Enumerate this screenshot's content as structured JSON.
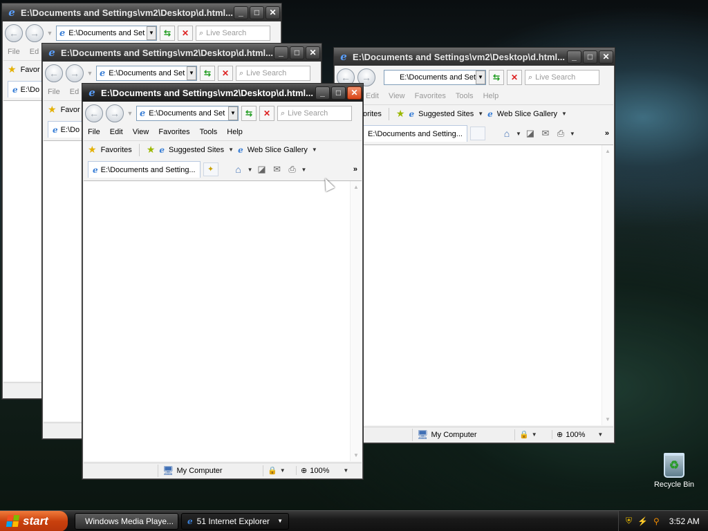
{
  "window": {
    "title": "E:\\Documents and Settings\\vm2\\Desktop\\d.html...",
    "address": "E:\\Documents and Set",
    "search_placeholder": "Live Search",
    "menu": [
      "File",
      "Edit",
      "View",
      "Favorites",
      "Tools",
      "Help"
    ],
    "favorites_label": "Favorites",
    "suggested_sites": "Suggested Sites",
    "web_slice_gallery": "Web Slice Gallery",
    "tab_label": "E:\\Documents and Setting...",
    "zone": "My Computer",
    "zoom": "100%"
  },
  "back_window_snippets": {
    "favorites_truncated": "Favor",
    "file": "File",
    "edit_truncated": "Ed",
    "tab_truncated": "E:\\Do",
    "tab_truncated_2": "E:\\D",
    "suggested_truncated": "orites",
    "doc_truncated": "Do"
  },
  "desktop": {
    "recycle_bin_label": "Recycle Bin"
  },
  "taskbar": {
    "start_label": "start",
    "tasks": [
      {
        "label": "Windows Media Playe..."
      },
      {
        "label": "51 Internet Explorer"
      }
    ],
    "clock": "3:52 AM"
  },
  "colors": {
    "start_button": "#d85718",
    "titlebar_active": "#2b2b2b",
    "close_red": "#d84417"
  }
}
